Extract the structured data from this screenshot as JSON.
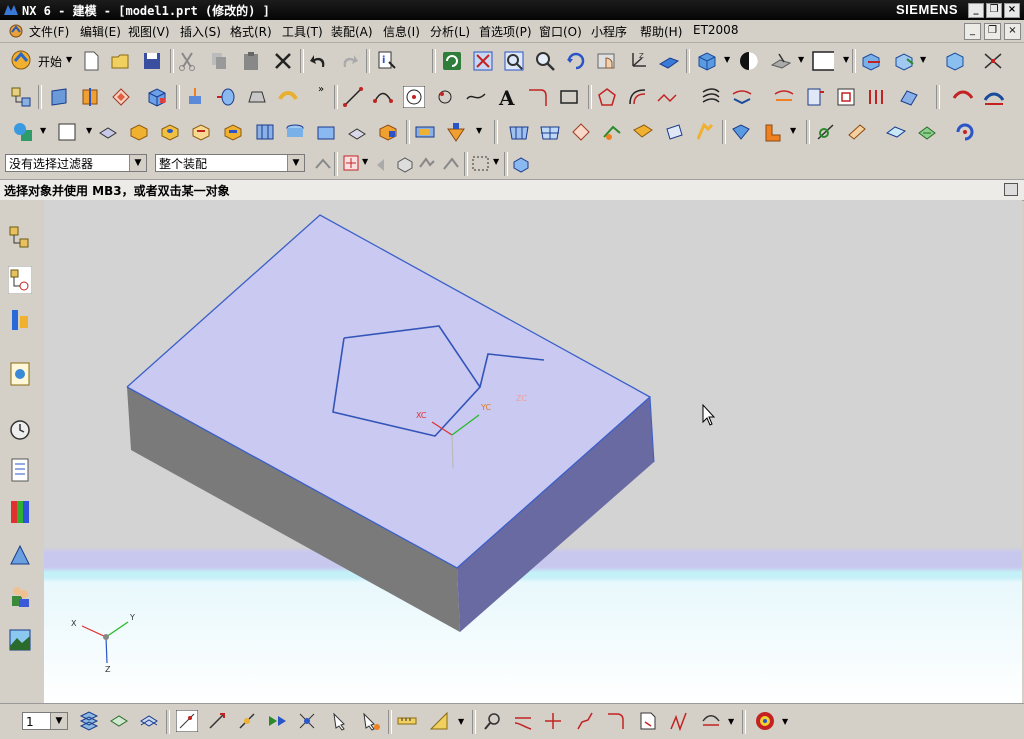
{
  "title": {
    "app_title": "NX 6 - 建模 - [model1.prt (修改的) ]",
    "brand": "SIEMENS",
    "win_min": "_",
    "win_restore": "❐",
    "win_close": "×"
  },
  "menu": {
    "items": [
      "文件(F)",
      "编辑(E)",
      "视图(V)",
      "插入(S)",
      "格式(R)",
      "工具(T)",
      "装配(A)",
      "信息(I)",
      "分析(L)",
      "首选项(P)",
      "窗口(O)",
      "小程序",
      "帮助(H)",
      "ET2008"
    ]
  },
  "toolbar": {
    "start_label": "开始"
  },
  "filter": {
    "selection_filter": "没有选择过滤器",
    "scope": "整个装配"
  },
  "status": {
    "cue": "选择对象并使用 MB3，或者双击某一对象"
  },
  "viewport": {
    "wcs_x_label": "XC",
    "wcs_y_label": "YC",
    "wcs_z_label": "ZC",
    "triad_x": "X",
    "triad_y": "Y",
    "triad_z": "Z",
    "colors": {
      "background_top": "#d3d3d3",
      "background_bottom": "#ffffff",
      "block_top": "#c9c9f2",
      "block_left": "#7a7a7a",
      "block_right": "#6a6aa2",
      "edge": "#3a5fc9",
      "sketch": "#3355b8"
    }
  },
  "bottom": {
    "layer_value": "1"
  }
}
